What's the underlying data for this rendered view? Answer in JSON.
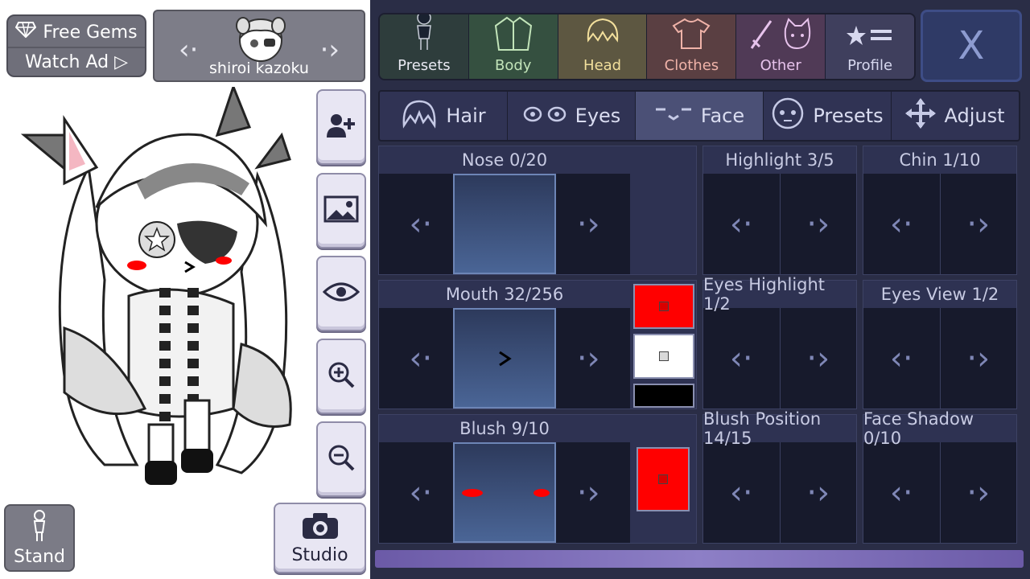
{
  "top_left": {
    "gems_label": "Free Gems",
    "ad_label": "Watch Ad ▷",
    "character_name": "shiroi kazoku",
    "prev_arrow": "‹·",
    "next_arrow": "·›"
  },
  "left_buttons": {
    "stand_label": "Stand",
    "studio_label": "Studio"
  },
  "tabs": [
    {
      "label": "Presets",
      "color": "#2e3d3c",
      "text_color": "#e9e9f2"
    },
    {
      "label": "Body",
      "color": "#355040",
      "text_color": "#c2e4b9"
    },
    {
      "label": "Head",
      "color": "#5d5741",
      "text_color": "#f2df9c"
    },
    {
      "label": "Clothes",
      "color": "#5a3f42",
      "text_color": "#f0b3a9"
    },
    {
      "label": "Other",
      "color": "#503a56",
      "text_color": "#e7c3ec"
    },
    {
      "label": "Profile",
      "color": "#3f3f5d",
      "text_color": "#d7d8ef"
    }
  ],
  "close_label": "X",
  "subtabs": [
    {
      "label": "Hair"
    },
    {
      "label": "Eyes"
    },
    {
      "label": "Face"
    },
    {
      "label": "Presets"
    },
    {
      "label": "Adjust"
    }
  ],
  "options": {
    "nose": "Nose 0/20",
    "highlight": "Highlight 3/5",
    "chin": "Chin 1/10",
    "mouth": "Mouth 32/256",
    "eyes_highlight": "Eyes Highlight 1/2",
    "eyes_view": "Eyes View 1/2",
    "blush": "Blush 9/10",
    "blush_position": "Blush Position 14/15",
    "face_shadow": "Face Shadow 0/10"
  },
  "colors": {
    "mouth_primary": "#ff0000",
    "mouth_secondary": "#ffffff",
    "mouth_tertiary": "#000000",
    "blush": "#ff0000"
  }
}
